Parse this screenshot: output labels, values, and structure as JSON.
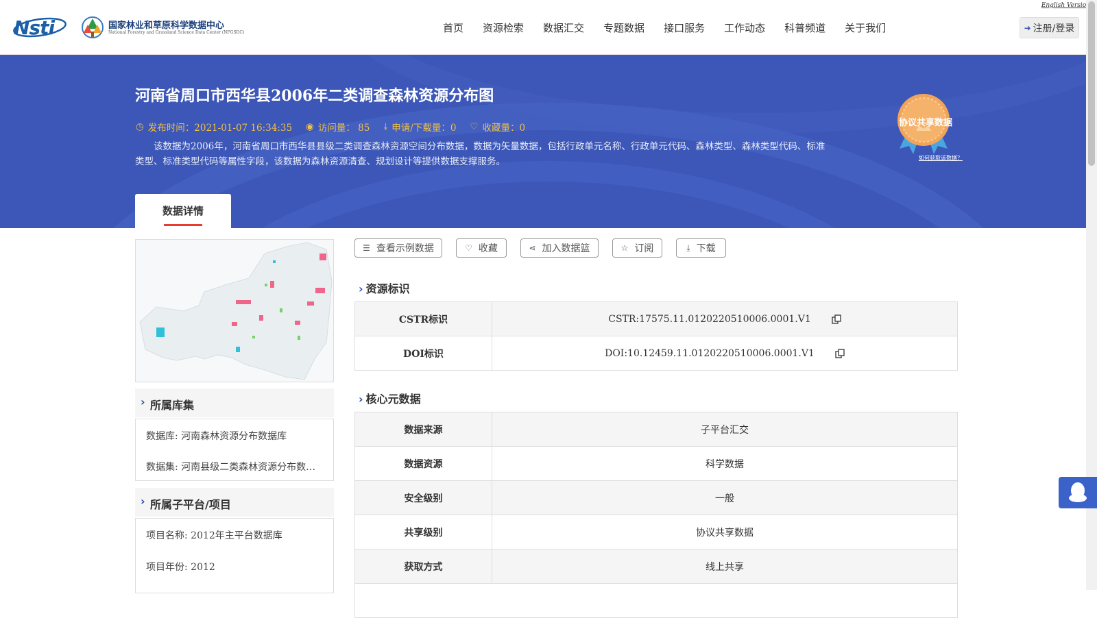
{
  "header": {
    "logo_left": "Nsti",
    "logo_center_cn": "国家林业和草原科学数据中心",
    "logo_center_en": "National Forestry and Grassland Science Data Center (NFGSDC)",
    "english_version": "English Version",
    "nav": [
      "首页",
      "资源检索",
      "数据汇交",
      "专题数据",
      "接口服务",
      "工作动态",
      "科普频道",
      "关于我们"
    ],
    "login": "注册/登录"
  },
  "banner": {
    "title": "河南省周口市西华县2006年二类调查森林资源分布图",
    "publish_time": "发布时间：2021-01-07 16:34:35",
    "visits": "访问量： 85",
    "downloads": "申请/下载量：0",
    "favorites": "收藏量：0",
    "description": "该数据为2006年，河南省周口市西华县县级二类调查森林资源空间分布数据，数据为矢量数据，包括行政单元名称、行政单元代码、森林类型、森林类型代码、标准类型、标准类型代码等属性字段，该数据为森林资源清查、规划设计等提供数据支撑服务。",
    "badge_label": "协议共享数据",
    "badge_link": "如何获取该数据？",
    "tab": "数据详情"
  },
  "colors": {
    "banner": "#3c57b8",
    "accent_yellow": "#f2c044",
    "tab_underline": "#e53e2e"
  },
  "sidebar": {
    "library_title": "所属库集",
    "library_rows": [
      "数据库: 河南森林资源分布数据库",
      "数据集: 河南县级二类森林资源分布数据集"
    ],
    "platform_title": "所属子平台/项目",
    "platform_rows": [
      "项目名称: 2012年主平台数据库",
      "项目年份: 2012"
    ]
  },
  "actions": [
    "查看示例数据",
    "收藏",
    "加入数据篮",
    "订阅",
    "下载"
  ],
  "resource_id": {
    "title": "资源标识",
    "rows": [
      {
        "key": "CSTR标识",
        "value": "CSTR:17575.11.0120220510006.0001.V1"
      },
      {
        "key": "DOI标识",
        "value": "DOI:10.12459.11.0120220510006.0001.V1"
      }
    ]
  },
  "core_meta": {
    "title": "核心元数据",
    "rows": [
      {
        "key": "数据来源",
        "value": "子平台汇交"
      },
      {
        "key": "数据资源",
        "value": "科学数据"
      },
      {
        "key": "安全级别",
        "value": "一般"
      },
      {
        "key": "共享级别",
        "value": "协议共享数据"
      },
      {
        "key": "获取方式",
        "value": "线上共享"
      }
    ]
  }
}
